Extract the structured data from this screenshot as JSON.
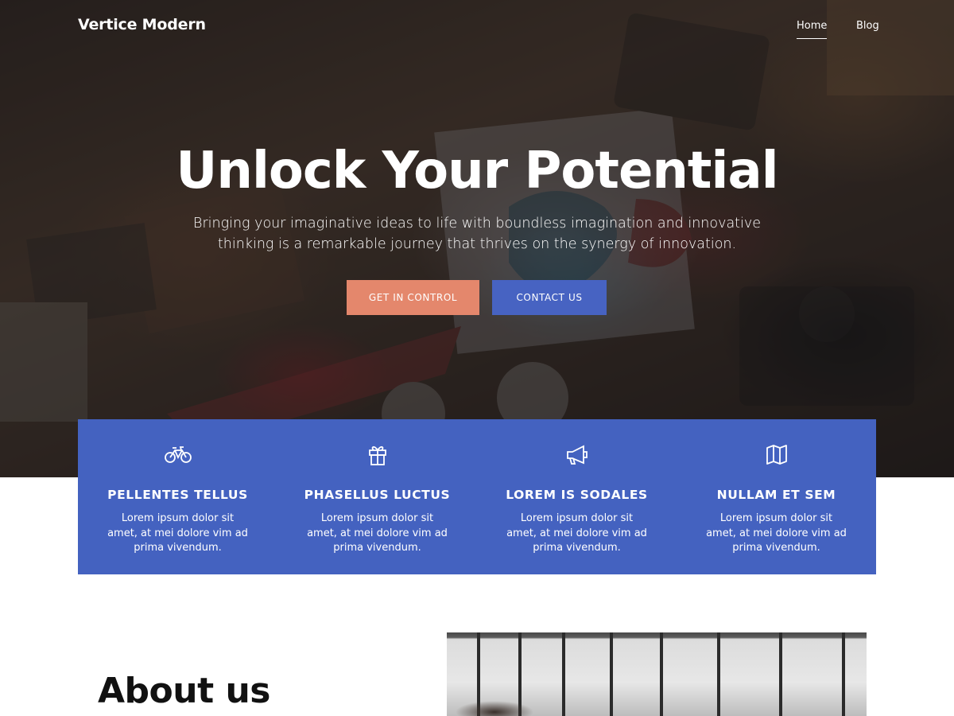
{
  "site": {
    "brand": "Vertice Modern"
  },
  "nav": {
    "items": [
      {
        "label": "Home",
        "active": true
      },
      {
        "label": "Blog",
        "active": false
      }
    ]
  },
  "hero": {
    "title": "Unlock Your Potential",
    "subtitle": "Bringing your imaginative ideas to life with boundless imagination and innovative thinking is a remarkable journey that thrives on the synergy of innovation.",
    "primary_button": "GET IN CONTROL",
    "secondary_button": "CONTACT US"
  },
  "features": [
    {
      "icon": "bicycle-icon",
      "title": "PELLENTES TELLUS",
      "text": "Lorem ipsum dolor sit amet, at mei dolore vim ad prima vivendum."
    },
    {
      "icon": "gift-icon",
      "title": "PHASELLUS LUCTUS",
      "text": "Lorem ipsum dolor sit amet, at mei dolore vim ad prima vivendum."
    },
    {
      "icon": "megaphone-icon",
      "title": "LOREM IS SODALES",
      "text": "Lorem ipsum dolor sit amet, at mei dolore vim ad prima vivendum."
    },
    {
      "icon": "map-icon",
      "title": "NULLAM ET SEM",
      "text": "Lorem ipsum dolor sit amet, at mei dolore vim ad prima vivendum."
    }
  ],
  "about": {
    "title": "About us"
  },
  "colors": {
    "accent_orange": "#e4876c",
    "accent_blue": "#4763c2",
    "features_bg": "#4462c0"
  }
}
